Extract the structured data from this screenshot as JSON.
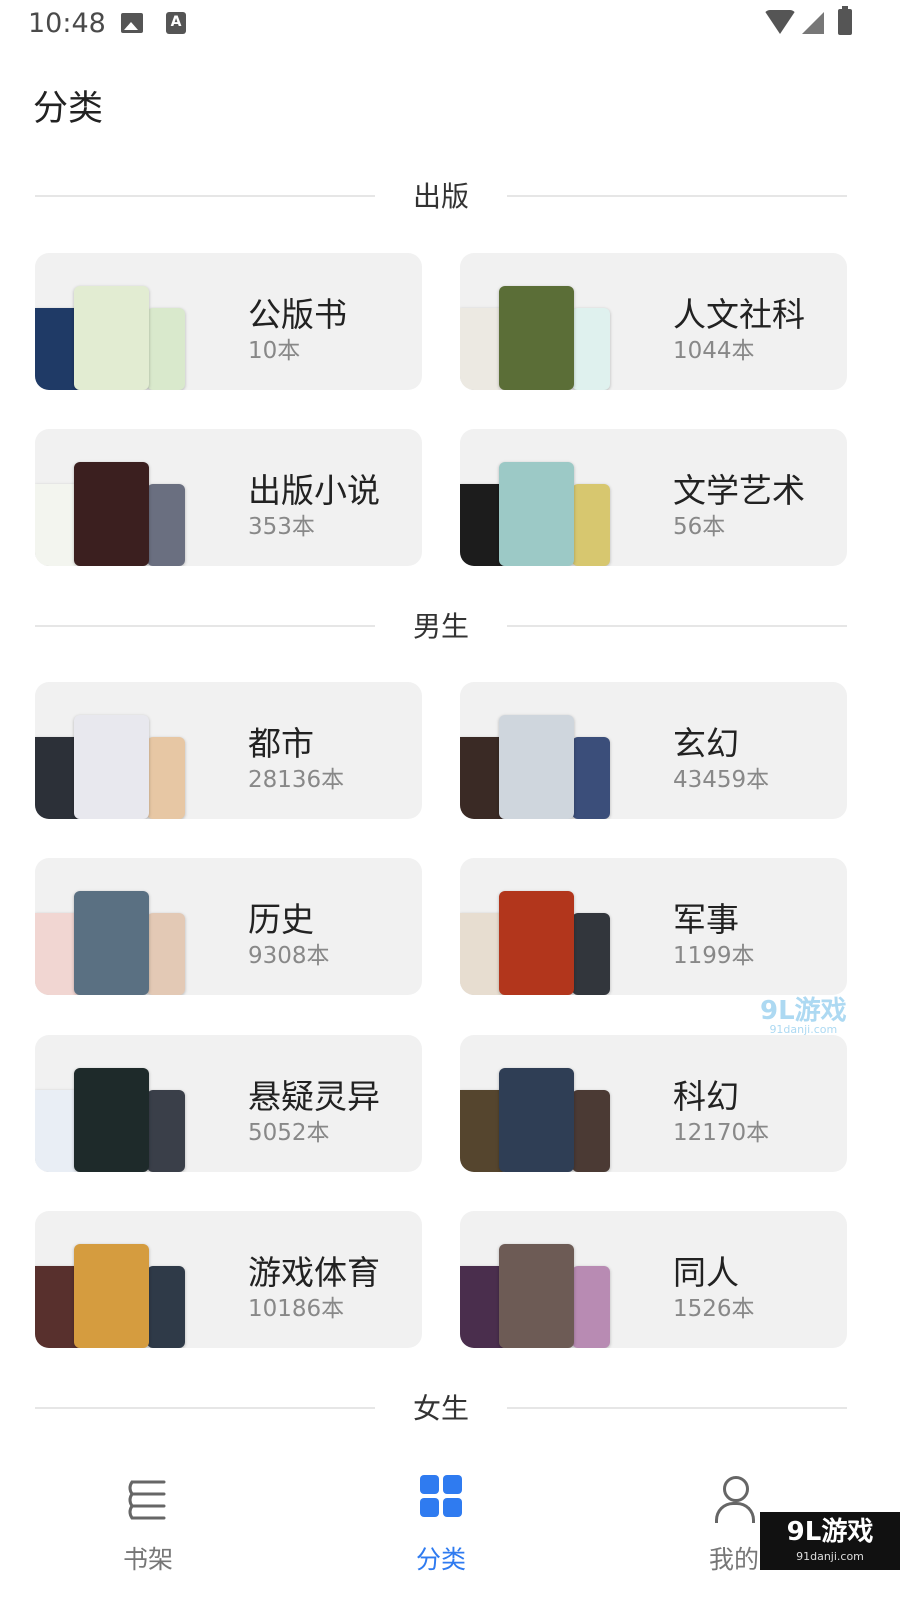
{
  "status_bar": {
    "time": "10:48"
  },
  "page_title": "分类",
  "sections": [
    {
      "label": "出版",
      "cards": [
        {
          "name": "公版书",
          "count": "10本",
          "covers": [
            "#1f3a66",
            "#e2ecd2",
            "#d9e9cc"
          ]
        },
        {
          "name": "人文社科",
          "count": "1044本",
          "covers": [
            "#ece9e2",
            "#5b6e37",
            "#dff1ee"
          ]
        },
        {
          "name": "出版小说",
          "count": "353本",
          "covers": [
            "#f3f5ef",
            "#3b1f1f",
            "#6a6f80"
          ]
        },
        {
          "name": "文学艺术",
          "count": "56本",
          "covers": [
            "#1c1c1c",
            "#9cc9c6",
            "#d7c76f"
          ]
        }
      ]
    },
    {
      "label": "男生",
      "cards": [
        {
          "name": "都市",
          "count": "28136本",
          "covers": [
            "#2c3038",
            "#e8e8ee",
            "#e7c7a4"
          ]
        },
        {
          "name": "玄幻",
          "count": "43459本",
          "covers": [
            "#3a2a25",
            "#cfd6dd",
            "#3b4e7a"
          ]
        },
        {
          "name": "历史",
          "count": "9308本",
          "covers": [
            "#f1d6d2",
            "#5a7082",
            "#e3c9b5"
          ]
        },
        {
          "name": "军事",
          "count": "1199本",
          "covers": [
            "#e7ddd0",
            "#b2361c",
            "#32363c"
          ]
        },
        {
          "name": "悬疑灵异",
          "count": "5052本",
          "covers": [
            "#e9eef5",
            "#1e2a2a",
            "#3a3f49"
          ]
        },
        {
          "name": "科幻",
          "count": "12170本",
          "covers": [
            "#55452e",
            "#2f3e55",
            "#4b3a34"
          ]
        },
        {
          "name": "游戏体育",
          "count": "10186本",
          "covers": [
            "#58302d",
            "#d59c3f",
            "#2f3a48"
          ]
        },
        {
          "name": "同人",
          "count": "1526本",
          "covers": [
            "#4a2e4d",
            "#6d5b55",
            "#b88bb3"
          ]
        }
      ]
    },
    {
      "label": "女生",
      "cards": []
    }
  ],
  "watermark": {
    "text": "9L游戏",
    "sub": "91danji.com"
  },
  "bottom_nav": [
    {
      "label": "书架",
      "icon": "bookshelf-icon",
      "active": false
    },
    {
      "label": "分类",
      "icon": "category-grid-icon",
      "active": true
    },
    {
      "label": "我的",
      "icon": "user-icon",
      "active": false
    }
  ],
  "corner_badge": {
    "text": "9L游戏",
    "sub": "91danji.com"
  },
  "colors": {
    "accent": "#2f7bf0",
    "card_bg": "#f1f1f1",
    "muted_text": "#888888"
  }
}
